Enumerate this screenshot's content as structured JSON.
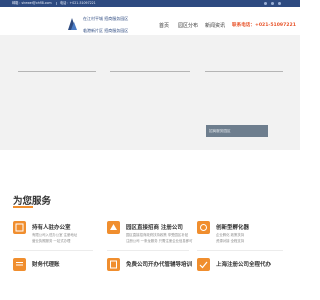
{
  "topbar": {
    "email": "邮箱：shewei@xhfl8.com",
    "phone": "电话：+021-51097221"
  },
  "header": {
    "tagline_line1": "在江村平城 招商服务园区",
    "tagline_line2": "临港新片区 招商服务园区",
    "nav": {
      "home": "首页",
      "park": "园区分布",
      "news": "新闻资讯"
    },
    "hotline": "联系电话：+021-51097221"
  },
  "hero": {
    "tag": "招商服务园区"
  },
  "services": {
    "title": "为您服务",
    "items": [
      {
        "title": "持有人驻办公室",
        "desc1": "有限公司入驻办公室 注册地址",
        "desc2": "营业执照服务 一站式办理"
      },
      {
        "title": "园区直接招商 注册公司",
        "desc1": "园区直接招商政府扶持政策 享受园区补贴",
        "desc2": "注册公司 一条龙服务 只需注册企业信息即可"
      },
      {
        "title": "创新型孵化器",
        "desc1": "企业孵化 政策扶持",
        "desc2": "资源对接 全程支持"
      },
      {
        "title": "财务代理账"
      },
      {
        "title": "免费公司开办代管辅导培训"
      },
      {
        "title": "上海注册公司全程代办"
      }
    ]
  },
  "colors": {
    "primary": "#2d4a80",
    "accent": "#f08e2e",
    "hotline": "#e8542a"
  },
  "icons": [
    "mail-icon",
    "phone-icon",
    "logo-icon",
    "office-icon",
    "park-icon",
    "incubator-icon",
    "finance-icon",
    "training-icon",
    "register-icon"
  ]
}
